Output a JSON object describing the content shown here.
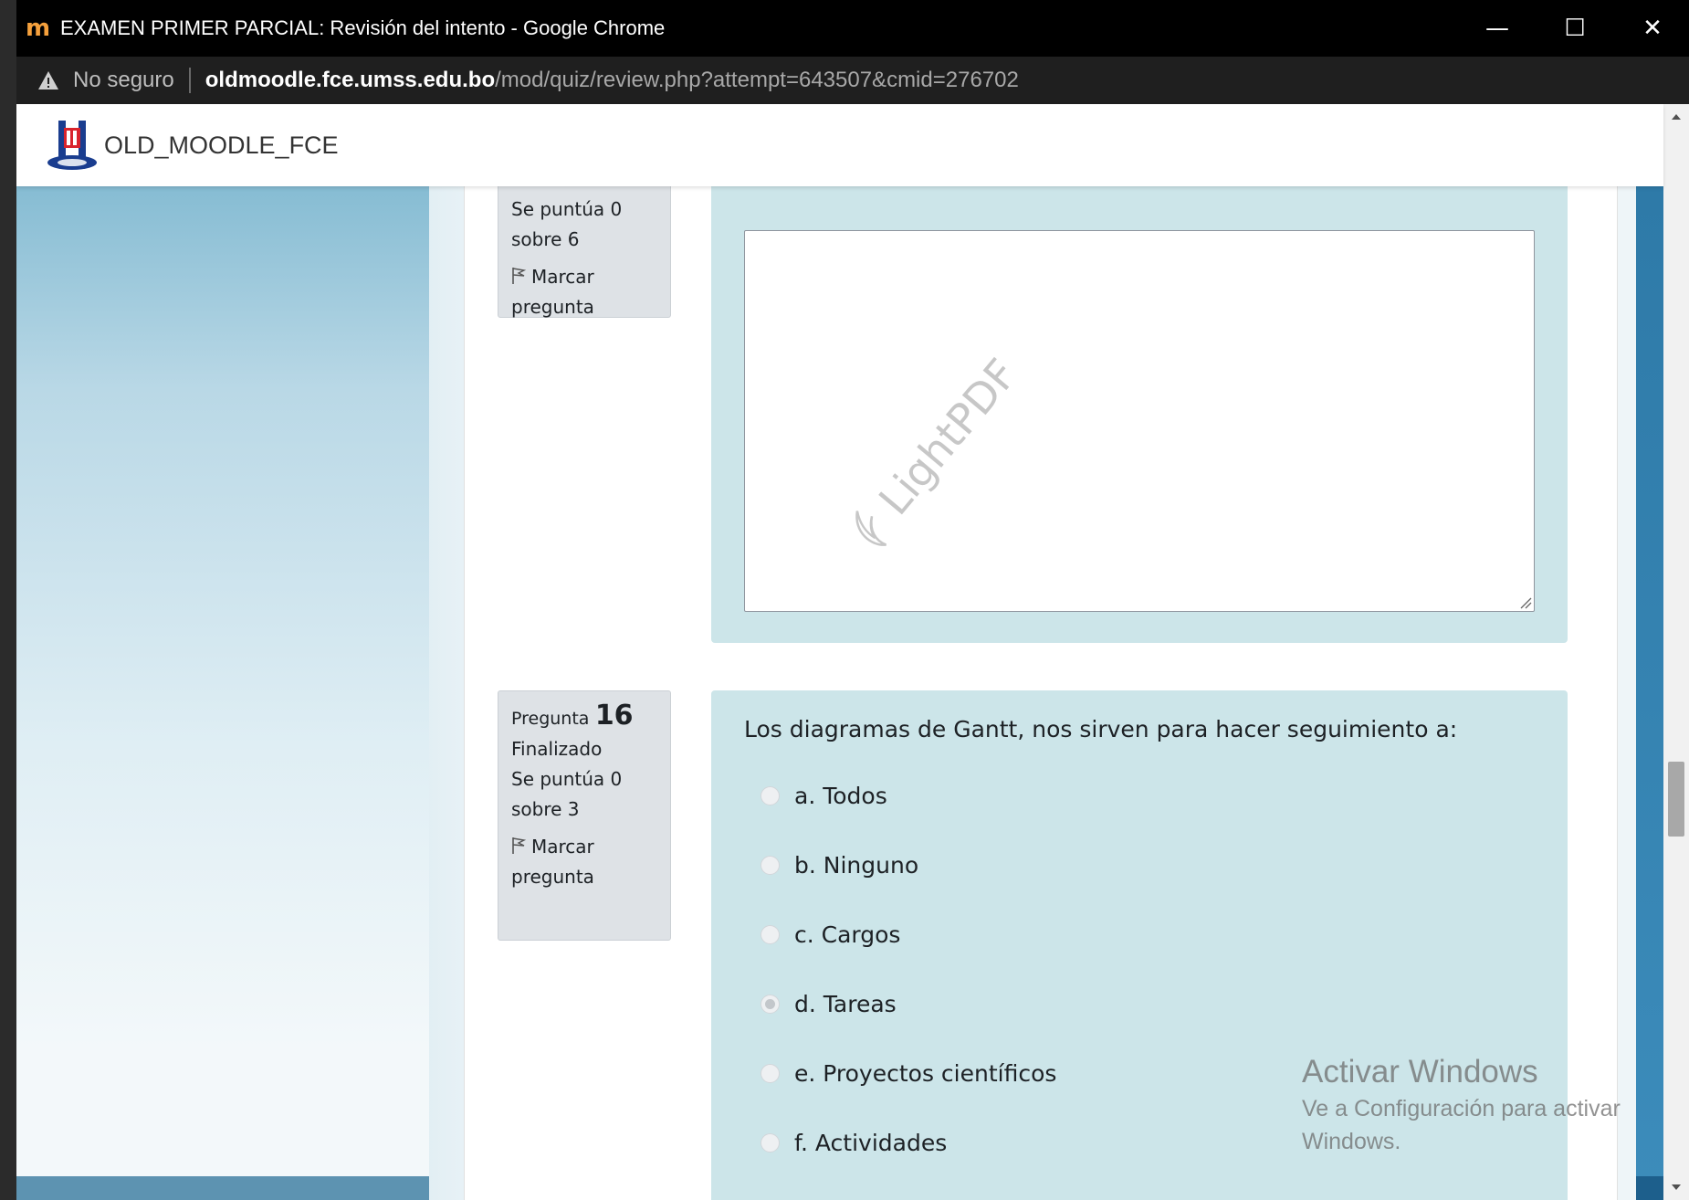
{
  "window": {
    "title": "EXAMEN PRIMER PARCIAL: Revisión del intento - Google Chrome",
    "min_glyph": "—",
    "max_glyph": "☐",
    "close_glyph": "✕"
  },
  "address_bar": {
    "security_label": "No seguro",
    "url_host": "oldmoodle.fce.umss.edu.bo",
    "url_path": "/mod/quiz/review.php?attempt=643507&cmid=276702"
  },
  "site": {
    "name": "OLD_MOODLE_FCE"
  },
  "questions": {
    "q15": {
      "score_line1": "Se puntúa 0",
      "score_line2": "sobre 6",
      "flag_line1": "Marcar",
      "flag_line2": "pregunta"
    },
    "q16": {
      "label": "Pregunta",
      "number": "16",
      "state": "Finalizado",
      "score_line1": "Se puntúa 0",
      "score_line2": "sobre 3",
      "flag_line1": "Marcar",
      "flag_line2": "pregunta",
      "text": "Los diagramas de Gantt, nos sirven para hacer seguimiento a:",
      "options": [
        {
          "label": "a. Todos",
          "checked": false
        },
        {
          "label": "b. Ninguno",
          "checked": false
        },
        {
          "label": "c. Cargos",
          "checked": false
        },
        {
          "label": "d. Tareas",
          "checked": true
        },
        {
          "label": "e. Proyectos científicos",
          "checked": false
        },
        {
          "label": "f. Actividades",
          "checked": false
        }
      ]
    }
  },
  "watermarks": {
    "lightpdf": "LightPDF",
    "activate_title": "Activar Windows",
    "activate_sub": "Ve a Configuración para activar Windows."
  }
}
